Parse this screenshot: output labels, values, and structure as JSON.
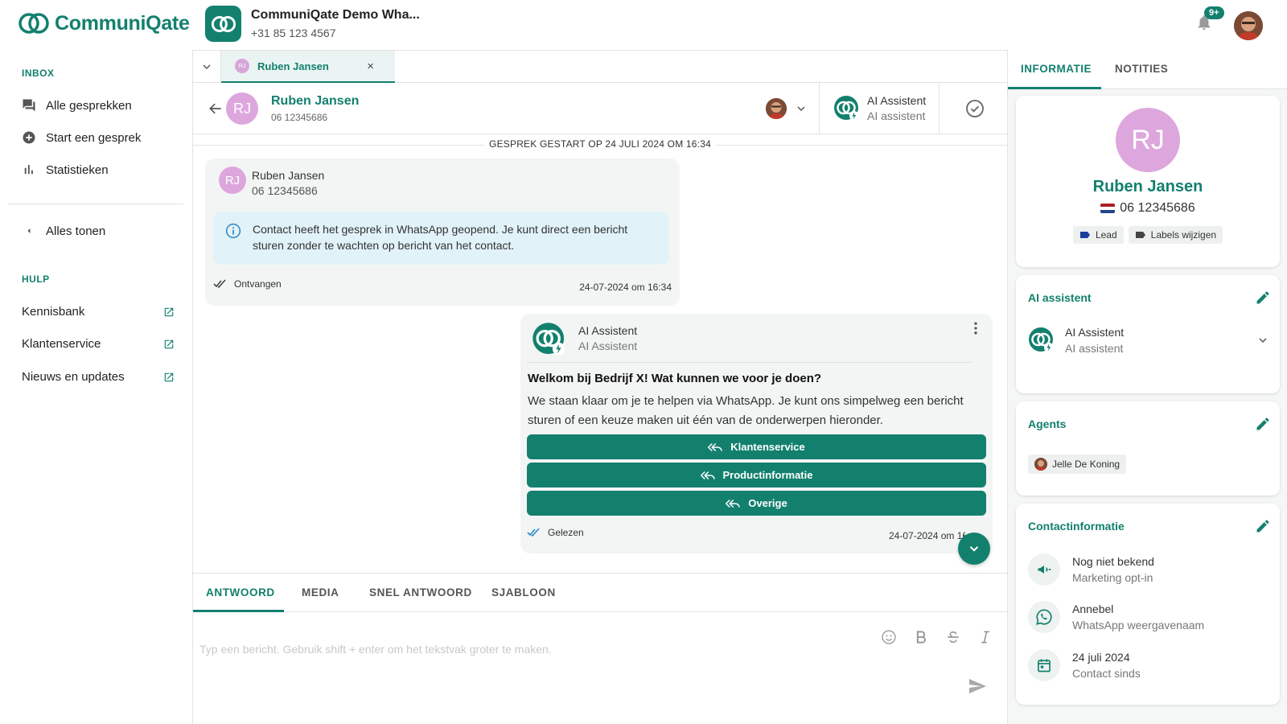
{
  "brand": {
    "name": "CommuniQate",
    "color": "#13806e"
  },
  "account": {
    "name": "CommuniQate Demo Wha...",
    "phone": "+31 85 123 4567"
  },
  "header": {
    "notification_badge": "9+"
  },
  "sidebar": {
    "inbox_heading": "INBOX",
    "items": [
      {
        "label": "Alle gesprekken",
        "icon": "chat-icon"
      },
      {
        "label": "Start een gesprek",
        "icon": "add-circle-icon"
      },
      {
        "label": "Statistieken",
        "icon": "bar-chart-icon"
      }
    ],
    "show_all": "Alles tonen",
    "help_heading": "HULP",
    "help_items": [
      {
        "label": "Kennisbank",
        "icon": "external-link-icon"
      },
      {
        "label": "Klantenservice",
        "icon": "external-link-icon"
      },
      {
        "label": "Nieuws en updates",
        "icon": "external-link-icon"
      }
    ]
  },
  "tab": {
    "initials": "RJ",
    "label": "Ruben Jansen",
    "close": "×"
  },
  "conversation": {
    "contact_initials": "RJ",
    "contact_name": "Ruben Jansen",
    "contact_phone": "06 12345686",
    "ai_title": "AI Assistent",
    "ai_subtitle": "AI assistent",
    "started": "GESPREK GESTART OP 24 JULI 2024 OM 16:34"
  },
  "messages": {
    "incoming": {
      "initials": "RJ",
      "sender": "Ruben Jansen",
      "phone": "06 12345686",
      "info": "Contact heeft het gesprek in WhatsApp geopend. Je kunt direct een bericht sturen zonder te wachten op bericht van het contact.",
      "status": "Ontvangen",
      "time": "24-07-2024 om 16:34"
    },
    "outgoing": {
      "sender": "AI Assistent",
      "sender_sub": "AI Assistent",
      "title": "Welkom bij Bedrijf X! Wat kunnen we voor je doen?",
      "body": "We staan klaar om je te helpen via WhatsApp. Je kunt ons simpelweg een bericht sturen of een keuze maken uit één van de onderwerpen hieronder.",
      "buttons": [
        "Klantenservice",
        "Productinformatie",
        "Overige"
      ],
      "status": "Gelezen",
      "time": "24-07-2024 om 16:34"
    }
  },
  "reply_tabs": [
    "ANTWOORD",
    "MEDIA",
    "SNEL ANTWOORD",
    "SJABLOON"
  ],
  "composer": {
    "placeholder": "Typ een bericht. Gebruik shift + enter om het tekstvak groter te maken."
  },
  "right_panel": {
    "tabs": [
      "INFORMATIE",
      "NOTITIES"
    ],
    "profile": {
      "initials": "RJ",
      "name": "Ruben Jansen",
      "phone": "06 12345686",
      "labels": [
        "Lead",
        "Labels wijzigen"
      ]
    },
    "ai_card": {
      "title": "AI assistent",
      "name": "AI Assistent",
      "subtitle": "AI assistent"
    },
    "agents_card": {
      "title": "Agents",
      "agent": "Jelle De Koning"
    },
    "contact_card": {
      "title": "Contactinformatie",
      "rows": [
        {
          "icon": "megaphone-icon",
          "value": "Nog niet bekend",
          "label": "Marketing opt-in"
        },
        {
          "icon": "whatsapp-icon",
          "value": "Annebel",
          "label": "WhatsApp weergavenaam"
        },
        {
          "icon": "calendar-icon",
          "value": "24 juli 2024",
          "label": "Contact sinds"
        }
      ]
    }
  }
}
